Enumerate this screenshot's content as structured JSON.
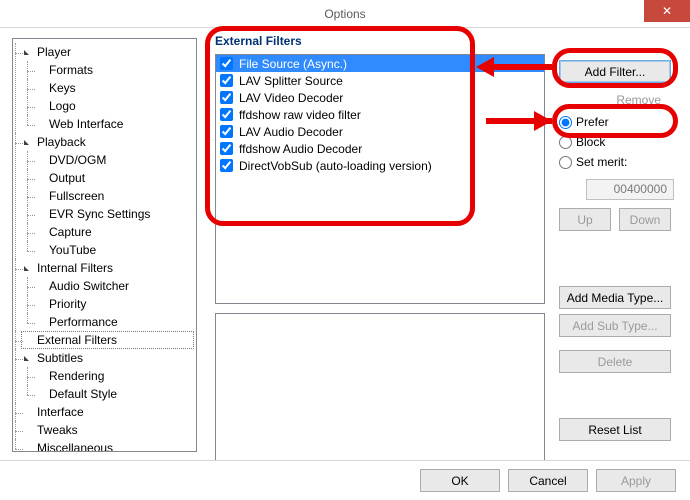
{
  "window": {
    "title": "Options",
    "close_glyph": "✕"
  },
  "tree": [
    {
      "label": "Player",
      "expanded": true,
      "children": [
        {
          "label": "Formats"
        },
        {
          "label": "Keys"
        },
        {
          "label": "Logo"
        },
        {
          "label": "Web Interface"
        }
      ]
    },
    {
      "label": "Playback",
      "expanded": true,
      "children": [
        {
          "label": "DVD/OGM"
        },
        {
          "label": "Output"
        },
        {
          "label": "Fullscreen"
        },
        {
          "label": "EVR Sync Settings"
        },
        {
          "label": "Capture"
        },
        {
          "label": "YouTube"
        }
      ]
    },
    {
      "label": "Internal Filters",
      "expanded": true,
      "children": [
        {
          "label": "Audio Switcher"
        },
        {
          "label": "Priority"
        },
        {
          "label": "Performance"
        }
      ]
    },
    {
      "label": "External Filters",
      "selected": true
    },
    {
      "label": "Subtitles",
      "expanded": true,
      "children": [
        {
          "label": "Rendering"
        },
        {
          "label": "Default Style"
        }
      ]
    },
    {
      "label": "Interface"
    },
    {
      "label": "Tweaks"
    },
    {
      "label": "Miscellaneous"
    }
  ],
  "group_title": "External Filters",
  "filters": [
    {
      "label": "File Source (Async.)",
      "checked": true,
      "selected": true
    },
    {
      "label": "LAV Splitter Source",
      "checked": true
    },
    {
      "label": "LAV Video Decoder",
      "checked": true
    },
    {
      "label": "ffdshow raw video filter",
      "checked": true
    },
    {
      "label": "LAV Audio Decoder",
      "checked": true
    },
    {
      "label": "ffdshow Audio Decoder",
      "checked": true
    },
    {
      "label": "DirectVobSub (auto-loading version)",
      "checked": true
    }
  ],
  "buttons": {
    "add_filter": "Add Filter...",
    "remove": "Remove",
    "up": "Up",
    "down": "Down",
    "add_media": "Add Media Type...",
    "add_sub": "Add Sub Type...",
    "delete": "Delete",
    "reset": "Reset List",
    "ok": "OK",
    "cancel": "Cancel",
    "apply": "Apply"
  },
  "radios": {
    "prefer": "Prefer",
    "block": "Block",
    "set_merit": "Set merit:",
    "merit_value": "00400000",
    "selected": "prefer"
  }
}
